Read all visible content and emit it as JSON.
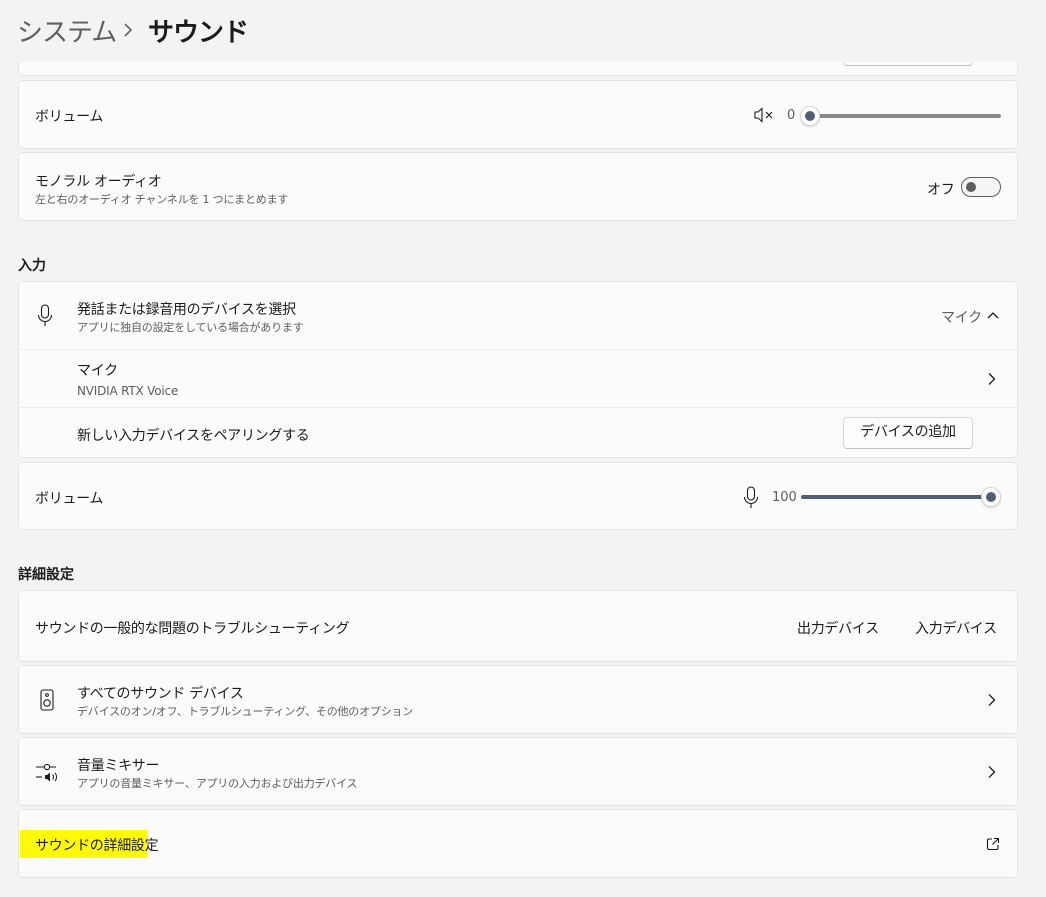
{
  "breadcrumb": {
    "parent": "システム",
    "current": "サウンド"
  },
  "output": {
    "volume_label": "ボリューム",
    "volume_value": "0",
    "volume_level": 0,
    "mono_title": "モノラル オーディオ",
    "mono_desc": "左と右のオーディオ チャンネルを 1 つにまとめます",
    "mono_state": "オフ"
  },
  "input": {
    "heading": "入力",
    "select_title": "発話または録音用のデバイスを選択",
    "select_desc": "アプリに独自の設定をしている場合があります",
    "selected_device": "マイク",
    "device_name": "マイク",
    "device_detail": "NVIDIA RTX Voice",
    "pair_label": "新しい入力デバイスをペアリングする",
    "add_device_button": "デバイスの追加",
    "volume_label": "ボリューム",
    "volume_value": "100",
    "volume_level": 100
  },
  "advanced": {
    "heading": "詳細設定",
    "troubleshoot_label": "サウンドの一般的な問題のトラブルシューティング",
    "output_devices_button": "出力デバイス",
    "input_devices_button": "入力デバイス",
    "all_devices_title": "すべてのサウンド デバイス",
    "all_devices_desc": "デバイスのオン/オフ、トラブルシューティング、その他のオプション",
    "mixer_title": "音量ミキサー",
    "mixer_desc": "アプリの音量ミキサー、アプリの入力および出力デバイス",
    "more_settings_label": "サウンドの詳細設定"
  },
  "colors": {
    "background": "#f3f3f3",
    "card": "#fbfbfb",
    "accent": "#4f5f75",
    "highlight": "#fffa00"
  },
  "icons": [
    "chevron-right-icon",
    "speaker-mute-icon",
    "microphone-icon",
    "chevron-up-icon",
    "speaker-device-icon",
    "mixer-icon",
    "open-external-icon"
  ]
}
